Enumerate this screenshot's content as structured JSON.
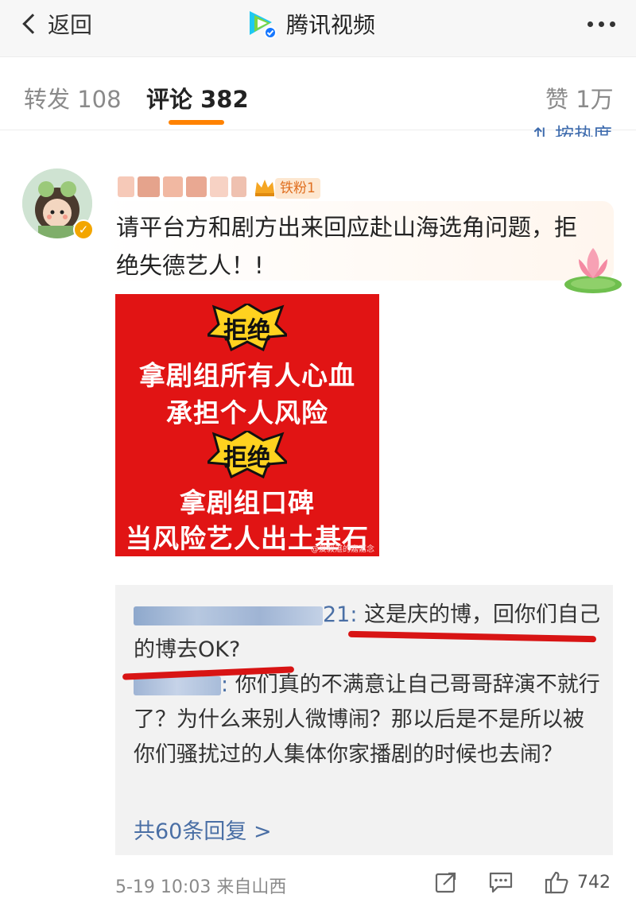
{
  "nav": {
    "back_label": "返回",
    "title": "腾讯视频",
    "more_icon": "more-dots-icon"
  },
  "tabs": {
    "repost": "转发 108",
    "comment": "评论 382",
    "like": "赞 1万",
    "sort_label": "按热度"
  },
  "colors": {
    "accent": "#ff8200",
    "link": "#4a6fa5",
    "poster_red": "#e11414",
    "annotation_red": "#d81414"
  },
  "comment": {
    "badge": "铁粉1",
    "text": "请平台方和剧方出来回应赴山海选角问题，拒绝失德艺人！!",
    "image": {
      "burst1": "拒绝",
      "line1": "拿剧组所有人心血",
      "line2": "承担个人风险",
      "burst2": "拒绝",
      "line3": "拿剧组口碑",
      "line4": "当风险艺人出土基石",
      "watermark": "@爱毅湛的嘉嘉念"
    },
    "replies": [
      {
        "name_suffix": "21:",
        "text": "这是庆的博，回你们自己的博去OK?"
      },
      {
        "name_suffix": ":",
        "text": "你们真的不满意让自己哥哥辞演不就行了？为什么来别人微博闹？那以后是不是所以被你们骚扰过的人集体你家播剧的时候也去闹？"
      }
    ],
    "more_replies": "共60条回复 >",
    "meta": "5-19 10:03  来自山西",
    "like_count": "742"
  }
}
